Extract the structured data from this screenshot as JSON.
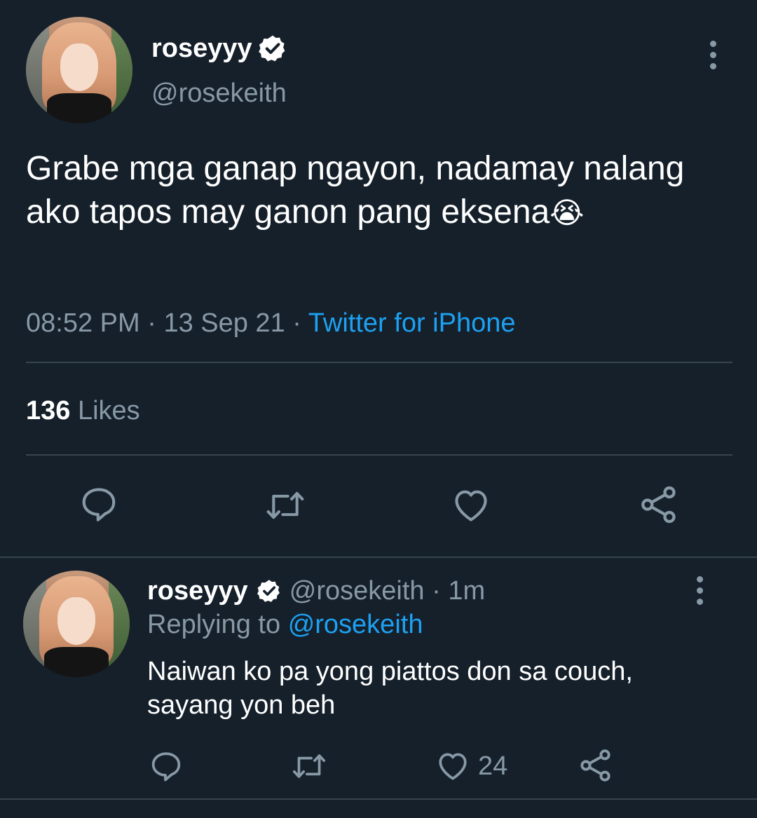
{
  "main_tweet": {
    "display_name": "roseyyy",
    "handle": "@rosekeith",
    "text": "Grabe mga ganap ngayon, nadamay nalang ako tapos may ganon pang eksena",
    "emoji": "😭",
    "time": "08:52 PM",
    "date": "13 Sep 21",
    "separator": "·",
    "source": "Twitter for iPhone",
    "likes_count": "136",
    "likes_label": "Likes"
  },
  "reply": {
    "display_name": "roseyyy",
    "handle": "@rosekeith",
    "separator": "·",
    "age": "1m",
    "replying_label": "Replying to",
    "replying_to": "@rosekeith",
    "text_line1": "Naiwan ko pa yong piattos don sa couch,",
    "text_line2": "sayang yon beh",
    "like_count": "24"
  },
  "colors": {
    "background": "#15202b",
    "text": "#ffffff",
    "muted": "#8899a6",
    "link": "#1da1f2",
    "divider": "#38444d"
  },
  "icons": [
    "verified-badge-icon",
    "more-options-icon",
    "reply-icon",
    "retweet-icon",
    "like-icon",
    "share-icon"
  ]
}
